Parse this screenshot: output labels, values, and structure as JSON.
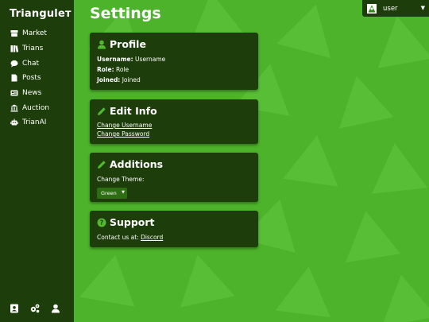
{
  "app": {
    "name": "Trianguleт"
  },
  "sidebar": {
    "items": [
      {
        "label": "Market",
        "icon": "store-icon"
      },
      {
        "label": "Trians",
        "icon": "books-icon"
      },
      {
        "label": "Chat",
        "icon": "chat-icon"
      },
      {
        "label": "Posts",
        "icon": "document-icon"
      },
      {
        "label": "News",
        "icon": "newspaper-icon"
      },
      {
        "label": "Auction",
        "icon": "bank-icon"
      },
      {
        "label": "TrianAI",
        "icon": "robot-icon"
      }
    ],
    "bottom_icons": [
      "contact-book-icon",
      "gears-icon",
      "user-icon"
    ]
  },
  "header": {
    "title": "Settings"
  },
  "user_menu": {
    "name": "user",
    "icon": "avatar-icon"
  },
  "profile": {
    "title": "Profile",
    "username_label": "Username:",
    "username_value": "Username",
    "role_label": "Role:",
    "role_value": "Role",
    "joined_label": "Joined:",
    "joined_value": "Joined"
  },
  "edit_info": {
    "title": "Edit Info",
    "change_username": "Change Username",
    "change_password": "Change Password"
  },
  "additions": {
    "title": "Additions",
    "theme_label": "Change Theme:",
    "theme_value": "Green"
  },
  "support": {
    "title": "Support",
    "contact_text": "Contact us at:",
    "discord_link": "Discord"
  },
  "colors": {
    "background": "#4db32a",
    "panel": "#1d3d0a",
    "accent": "#52b830"
  }
}
